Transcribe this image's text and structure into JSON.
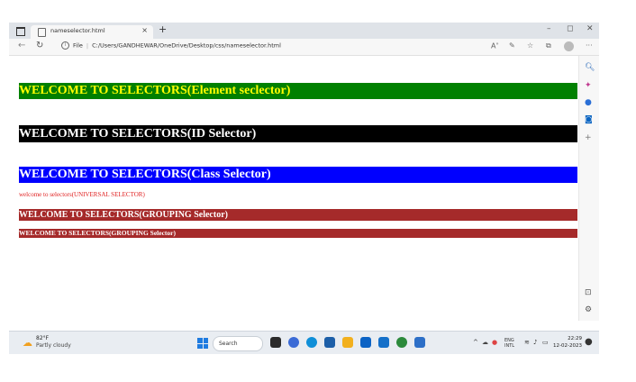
{
  "browser": {
    "tab_title": "nameselector.html",
    "tab_close": "×",
    "new_tab": "+",
    "min": "–",
    "restore": "◻",
    "close": "✕",
    "url_scheme": "File",
    "url": "C:/Users/GANDHEWAR/OneDrive/Desktop/css/nameselector.html"
  },
  "page": {
    "heading_element": "WELCOME TO SELECTORS(Element seclector)",
    "heading_id": "WELCOME TO SELECTORS(ID Selector)",
    "heading_class": "WELCOME TO SELECTORS(Class Selector)",
    "universal": "welcome to selectors(UNIVERSAL SELECTOR)",
    "grouping_h2": "WELCOME TO SELECTORS(GROUPING Selector)",
    "grouping_h3": "WELCOME TO SELECTORS(GROUPING Selector)"
  },
  "colors": {
    "element_bg": "#008000",
    "element_fg": "#ffff00",
    "id_bg": "#000000",
    "id_fg": "#ffffff",
    "class_bg": "#0000ff",
    "class_fg": "#ffffff",
    "universal_fg": "#e02020",
    "grouping_bg": "#a52a2a",
    "grouping_fg": "#ffffff"
  },
  "taskbar": {
    "weather_temp": "82°F",
    "weather_desc": "Partly cloudy",
    "search_label": "Search",
    "lang_line1": "ENG",
    "lang_line2": "INTL",
    "time": "22:29",
    "date": "12-02-2023"
  },
  "icons": [
    "tab-actions-icon",
    "page-icon",
    "back-icon",
    "refresh-icon",
    "info-icon",
    "read-aloud-icon",
    "extensions-icon",
    "favorites-icon",
    "collections-icon",
    "profile-icon",
    "more-icon",
    "search-icon",
    "sparkle-icon",
    "office-icon",
    "outlook-icon",
    "plus-icon",
    "sidebar-toggle-icon",
    "settings-icon",
    "windows-icon",
    "wifi-icon",
    "volume-icon",
    "battery-icon"
  ]
}
